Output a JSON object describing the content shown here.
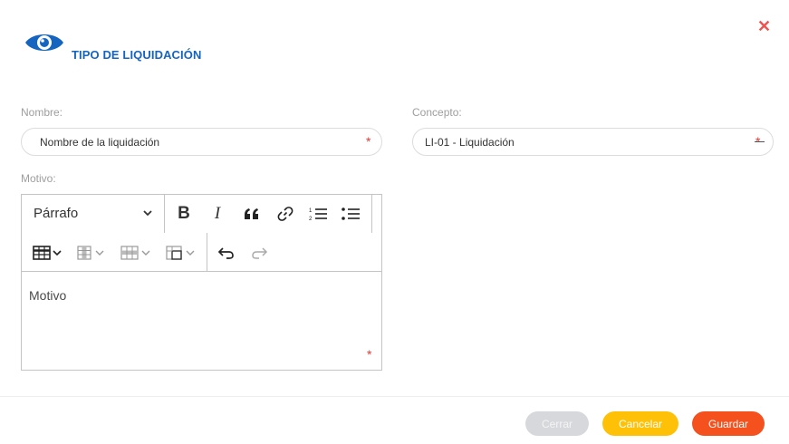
{
  "header": {
    "title": "TIPO DE LIQUIDACIÓN",
    "icon": "eye-icon",
    "icon_color": "#1565c0",
    "close_symbol": "✕",
    "close_color": "#ef5350"
  },
  "form": {
    "nombre": {
      "label": "Nombre:",
      "value": "Nombre de la liquidación",
      "required_mark": "*"
    },
    "concepto": {
      "label": "Concepto:",
      "value": "LI-01 - Liquidación",
      "required_mark": "*"
    },
    "motivo": {
      "label": "Motivo:",
      "placeholder": "Motivo",
      "required_mark": "*",
      "toolbar": {
        "paragraph_format": "Párrafo",
        "buttons": [
          "bold",
          "italic",
          "blockquote",
          "link",
          "numbered-list",
          "bulleted-list",
          "insert-table",
          "table-column",
          "table-row",
          "merge-cells",
          "undo",
          "redo"
        ]
      }
    }
  },
  "footer": {
    "cerrar": "Cerrar",
    "cancelar": "Cancelar",
    "guardar": "Guardar"
  },
  "colors": {
    "accent": "#1565c0",
    "required": "#e53935",
    "cancel": "#ffc107",
    "save": "#f4511e",
    "disabled": "#d6d8dc"
  }
}
